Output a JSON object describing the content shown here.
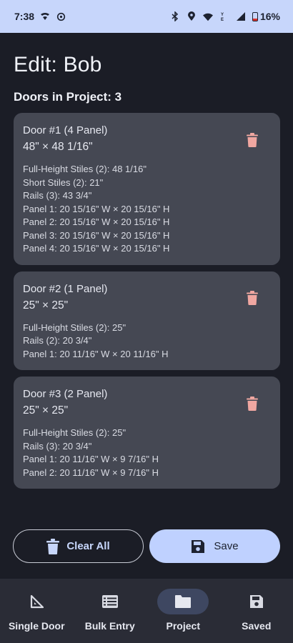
{
  "status": {
    "time": "7:38",
    "battery": "16%",
    "icons": [
      "wifi-calling-icon",
      "sync-icon",
      "bluetooth-icon",
      "location-icon",
      "wifi-icon",
      "lte-icon",
      "signal-icon",
      "battery-icon"
    ]
  },
  "title": "Edit: Bob",
  "section": "Doors in Project: 3",
  "doors": [
    {
      "name": "Door #1 (4 Panel)",
      "size": "48\" × 48 1/16\"",
      "details": [
        "Full-Height Stiles (2): 48 1/16\"",
        "Short Stiles (2): 21\"",
        "Rails (3): 43 3/4\"",
        "Panel 1: 20 15/16\" W × 20 15/16\" H",
        "Panel 2: 20 15/16\" W × 20 15/16\" H",
        "Panel 3: 20 15/16\" W × 20 15/16\" H",
        "Panel 4: 20 15/16\" W × 20 15/16\" H"
      ]
    },
    {
      "name": "Door #2 (1 Panel)",
      "size": "25\" × 25\"",
      "details": [
        "Full-Height Stiles (2): 25\"",
        "Rails (2): 20 3/4\"",
        "Panel 1: 20 11/16\" W × 20 11/16\" H"
      ]
    },
    {
      "name": "Door #3 (2 Panel)",
      "size": "25\" × 25\"",
      "details": [
        "Full-Height Stiles (2): 25\"",
        "Rails (3): 20 3/4\"",
        "Panel 1: 20 11/16\" W × 9 7/16\" H",
        "Panel 2: 20 11/16\" W × 9 7/16\" H"
      ]
    }
  ],
  "actions": {
    "clear_label": "Clear All",
    "save_label": "Save"
  },
  "nav": [
    {
      "label": "Single Door",
      "icon": "ruler-triangle-icon",
      "active": false
    },
    {
      "label": "Bulk Entry",
      "icon": "list-icon",
      "active": false
    },
    {
      "label": "Project",
      "icon": "folder-icon",
      "active": true
    },
    {
      "label": "Saved",
      "icon": "floppy-disk-icon",
      "active": false
    }
  ],
  "colors": {
    "status_bar": "#c7d6fb",
    "background": "#1b1d26",
    "card": "#454853",
    "delete_icon": "#f0a7a1",
    "save_button": "#bfd1ff",
    "nav_bar": "#2a2c36",
    "nav_active_pill": "#3e4761"
  }
}
